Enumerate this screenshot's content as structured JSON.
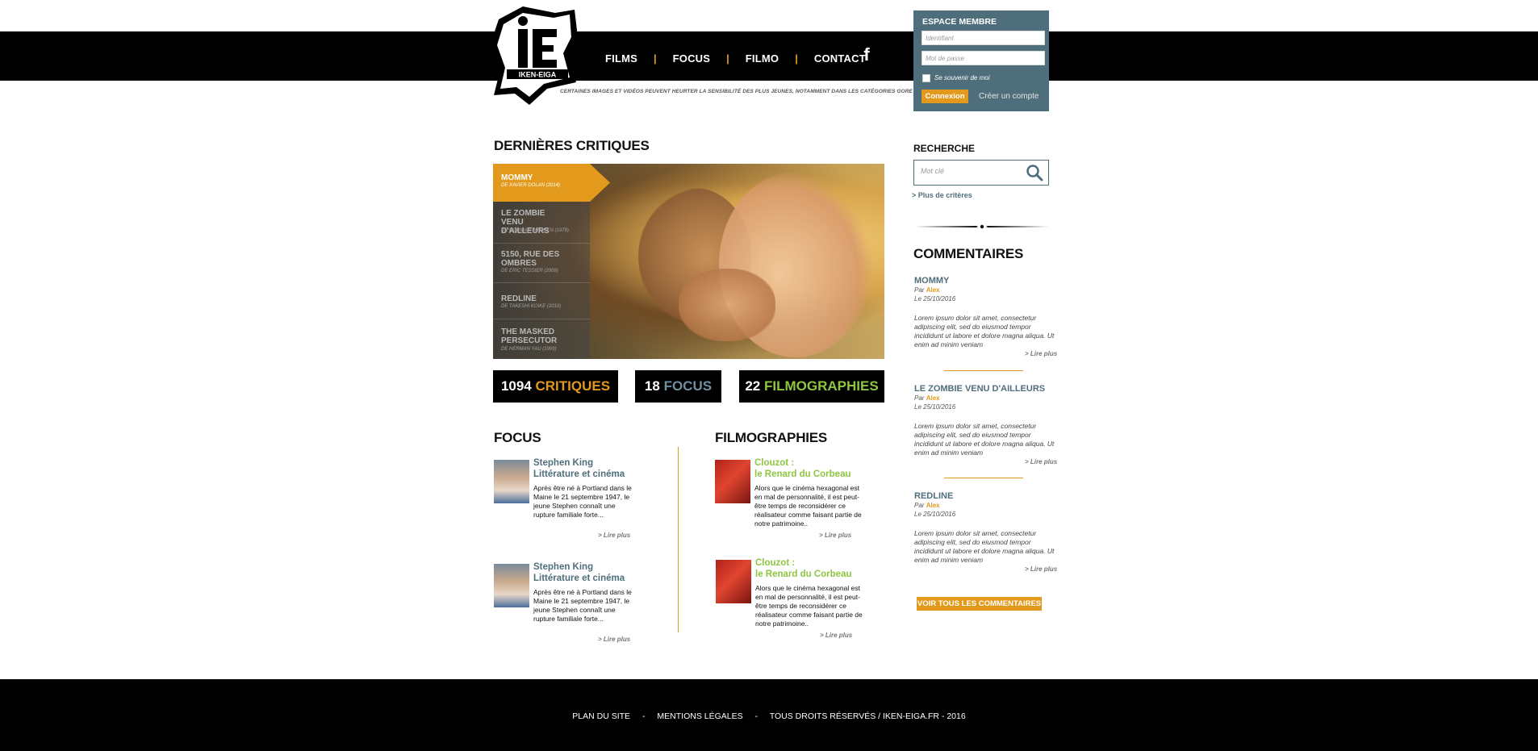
{
  "brand": {
    "logo_text": "IKEN-EIGA",
    "logo_letters": "IE"
  },
  "nav": {
    "items": [
      "FILMS",
      "FOCUS",
      "FILMO",
      "CONTACT"
    ],
    "facebook_icon": "f"
  },
  "warning": "CERTAINES IMAGES ET VIDÉOS PEUVENT HEURTER LA SENSIBILITÉ DES PLUS JEUNES, NOTAMMENT DANS LES CATÉGORIES GORE ET ÉROTIQUE.",
  "member": {
    "title": "ESPACE MEMBRE",
    "login_placeholder": "Identifiant",
    "password_placeholder": "Mot de passe",
    "remember_label": "Se souvenir de moi",
    "login_button": "Connexion",
    "create_account": "Créer un compte"
  },
  "latest": {
    "title": "DERNIÈRES CRITIQUES",
    "items": [
      {
        "title": "MOMMY",
        "subtitle": "DE XAVIER DOLAN (2014)"
      },
      {
        "title": "LE ZOMBIE VENU D'AILLEURS",
        "subtitle": "DE NORMAN WARREN (1978)"
      },
      {
        "title": "5150, RUE DES OMBRES",
        "subtitle": "DE ERIC TESSIER (2009)"
      },
      {
        "title": "REDLINE",
        "subtitle": "DE TAKESHI KOIKE  (2010)"
      },
      {
        "title": "THE MASKED PERSECUTOR",
        "subtitle": "DE HERMAN YAU (1999)"
      }
    ]
  },
  "counters": [
    {
      "number": "1094",
      "label": "CRITIQUES",
      "color": "#e39a1c"
    },
    {
      "number": "18",
      "label": "FOCUS",
      "color": "#6f8fa0"
    },
    {
      "number": "22",
      "label": "FILMOGRAPHIES",
      "color": "#8ec63f"
    }
  ],
  "focus": {
    "title": "FOCUS",
    "items": [
      {
        "title_line1": "Stephen King",
        "title_line2": "Littérature et cinéma",
        "text": "Après être né à Portland dans le Maine le 21 septembre 1947, le jeune Stephen connaît une rupture familiale forte...",
        "more": "> Lire plus"
      },
      {
        "title_line1": "Stephen King",
        "title_line2": "Littérature et cinéma",
        "text": "Après être né à Portland dans le Maine le 21 septembre 1947, le jeune Stephen connaît une rupture familiale forte...",
        "more": "> Lire plus"
      }
    ]
  },
  "filmographies": {
    "title": "FILMOGRAPHIES",
    "items": [
      {
        "title_line1": "Clouzot :",
        "title_line2": "le Renard du Corbeau",
        "text": "Alors que le cinéma hexagonal est en mal de personnalité, il est peut-être temps de reconsidérer ce réalisateur comme faisant partie de notre patrimoine..",
        "more": "> Lire plus"
      },
      {
        "title_line1": "Clouzot :",
        "title_line2": "le Renard du Corbeau",
        "text": "Alors que le cinéma hexagonal est en mal de personnalité, il est peut-être temps de reconsidérer ce réalisateur comme faisant partie de notre patrimoine..",
        "more": "> Lire plus"
      }
    ]
  },
  "search": {
    "title": "RECHERCHE",
    "placeholder": "Mot clé",
    "more_criteria": "> Plus de critères"
  },
  "comments": {
    "title": "COMMENTAIRES",
    "items": [
      {
        "title": "MOMMY",
        "by_prefix": "Par",
        "author": "Alex",
        "date": "Le 25/10/2016",
        "text": "Lorem ipsum dolor sit amet, consectetur adipiscing elit, sed do eiusmod tempor incididunt ut labore et dolore magna aliqua. Ut enim ad minim veniam",
        "more": "> Lire plus"
      },
      {
        "title": "LE ZOMBIE VENU D'AILLEURS",
        "by_prefix": "Par",
        "author": "Alex",
        "date": "Le 25/10/2016",
        "text": "Lorem ipsum dolor sit amet, consectetur adipiscing elit, sed do eiusmod tempor incididunt ut labore et dolore magna aliqua. Ut enim ad minim veniam",
        "more": "> Lire plus"
      },
      {
        "title": "REDLINE",
        "by_prefix": "Par",
        "author": "Alex",
        "date": "Le 25/10/2016",
        "text": "Lorem ipsum dolor sit amet, consectetur adipiscing elit, sed do eiusmod tempor incididunt ut labore et dolore magna aliqua. Ut enim ad minim veniam",
        "more": "> Lire plus"
      }
    ],
    "all_button": "VOIR TOUS LES COMMENTAIRES"
  },
  "footer": {
    "sitemap": "PLAN DU SITE",
    "separator": "-",
    "legal": "MENTIONS LÉGALES",
    "rights": "TOUS DROITS RÉSERVÉS / IKEN-EIGA.FR - 2016"
  },
  "colors": {
    "accent": "#e39a1c",
    "slate": "#4f6e7b",
    "green": "#8ec63f"
  }
}
